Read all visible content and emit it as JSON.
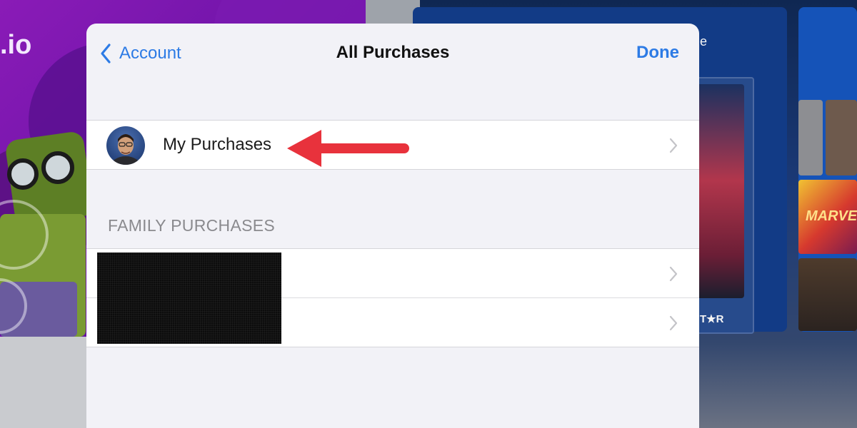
{
  "background": {
    "left_app_text": ".io",
    "right_app_tile_text": "T★R",
    "right_app_fragment": "e",
    "tile_marvel_text": "MARVEL"
  },
  "nav": {
    "back_label": "Account",
    "title": "All Purchases",
    "done_label": "Done"
  },
  "my_purchases": {
    "label": "My Purchases",
    "avatar_icon": "user-avatar"
  },
  "family": {
    "header": "FAMILY PURCHASES",
    "members": [
      {
        "label": ""
      },
      {
        "label": ""
      }
    ]
  },
  "colors": {
    "accent": "#2d7be5",
    "sheet_bg": "#f2f2f7",
    "annotation": "#e8323c"
  }
}
